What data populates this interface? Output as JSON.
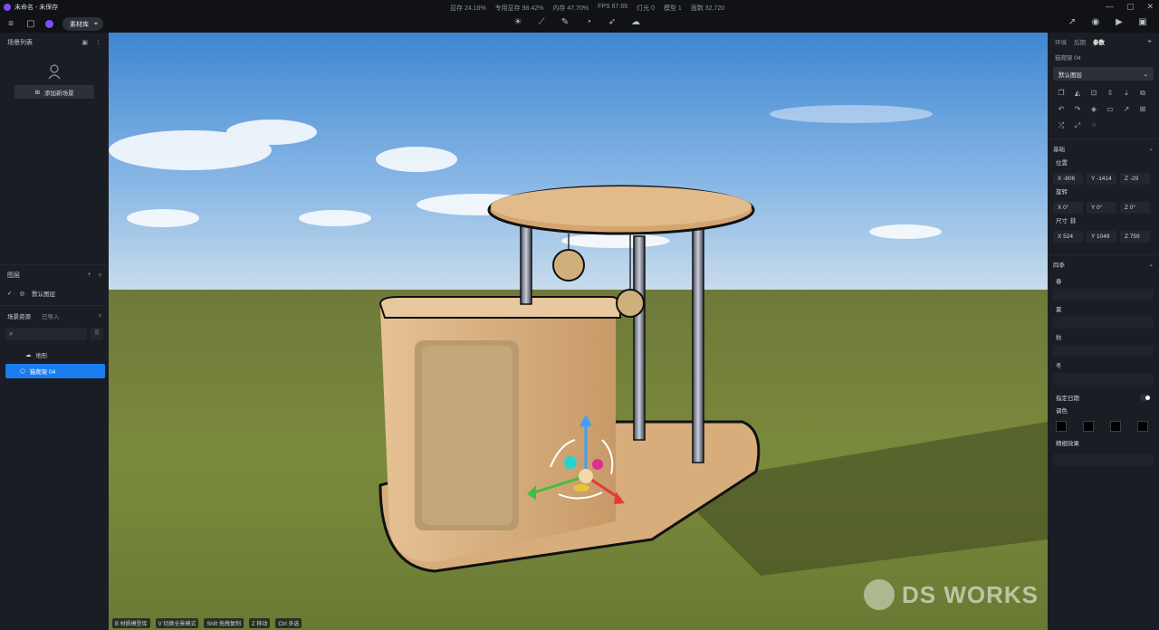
{
  "window": {
    "title": "未命名 - 未保存",
    "stats": [
      "显存 24.16%",
      "专用显存 98.42%",
      "内存 47.70%",
      "FPS 67.66",
      "灯光 0",
      "模型 1",
      "面数 32,720"
    ],
    "controls": [
      "—",
      "▢",
      "✕"
    ]
  },
  "toolbar": {
    "library_label": "素材库",
    "icons_left": [
      "menu-icon",
      "file-icon",
      "brand-badge-icon"
    ],
    "icons_center": [
      "light-icon",
      "measure-icon",
      "pen-icon",
      "orbit-icon",
      "select-icon",
      "cloud-icon"
    ],
    "icons_right": [
      "share-icon",
      "camera-icon",
      "video-icon",
      "inbox-icon"
    ]
  },
  "left_panel": {
    "scene_list_title": "场景列表",
    "add_scene_label": "添加新场景",
    "layers_title": "图层",
    "layer_default": "默认图层",
    "assets_title": "场景资源",
    "assets_imported": "已导入",
    "tree": [
      {
        "label": "地形",
        "selected": false
      },
      {
        "label": "猫爬架 04",
        "selected": true
      }
    ]
  },
  "right_panel": {
    "tabs": [
      "环境",
      "后期",
      "参数"
    ],
    "active_tab": "参数",
    "object_name": "猫爬架 04",
    "layer_select": "默认图层",
    "basic_title": "基础",
    "position_label": "位置",
    "position": {
      "x": "X  -806",
      "y": "Y  -1414",
      "z": "Z  -29"
    },
    "rotation_label": "旋转",
    "rotation": {
      "x": "X  0°",
      "y": "Y  0°",
      "z": "Z  0°"
    },
    "size_label": "尺寸",
    "size": {
      "x": "X  524",
      "y": "Y  1049",
      "z": "Z  759"
    },
    "seasons_title": "四季",
    "seasons": [
      "春",
      "夏",
      "秋",
      "冬"
    ],
    "date_label": "指定日期",
    "tint_label": "调色",
    "fine_label": "精细效果",
    "swatch_color": "#000000"
  },
  "viewport": {
    "status": [
      "B 材质模型库",
      "V 切换全景模式",
      "Shift 拖拽复制",
      "Z 移动",
      "Ctrl 多选"
    ],
    "watermark": "DS WORKS"
  }
}
